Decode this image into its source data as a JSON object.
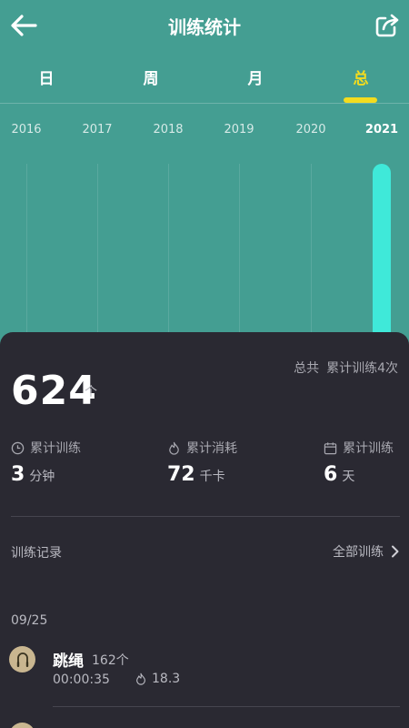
{
  "header": {
    "title": "训练统计"
  },
  "tabs": [
    {
      "label": "日",
      "active": false
    },
    {
      "label": "周",
      "active": false
    },
    {
      "label": "月",
      "active": false
    },
    {
      "label": "总",
      "active": true
    }
  ],
  "chart_data": {
    "type": "bar",
    "categories": [
      "2016",
      "2017",
      "2018",
      "2019",
      "2020",
      "2021"
    ],
    "values": [
      0,
      0,
      0,
      0,
      0,
      624
    ],
    "active_category": "2021"
  },
  "total": {
    "value": "624",
    "unit": "个"
  },
  "summary": {
    "label": "总共",
    "detail": "累计训练4次"
  },
  "stats": [
    {
      "icon": "clock-icon",
      "label": "累计训练",
      "value": "3",
      "unit": "分钟"
    },
    {
      "icon": "flame-icon",
      "label": "累计消耗",
      "value": "72",
      "unit": "千卡"
    },
    {
      "icon": "calendar-icon",
      "label": "累计训练",
      "value": "6",
      "unit": "天"
    }
  ],
  "records": {
    "title": "训练记录",
    "all_label": "全部训练",
    "date": "09/25",
    "items": [
      {
        "name": "跳绳",
        "count": "162个",
        "duration": "00:00:35",
        "calories": "18.3"
      }
    ]
  },
  "colors": {
    "teal": "#449e92",
    "bar": "#3fe9d9",
    "active_tab": "#f3dc1e",
    "dark": "#2a2932"
  }
}
